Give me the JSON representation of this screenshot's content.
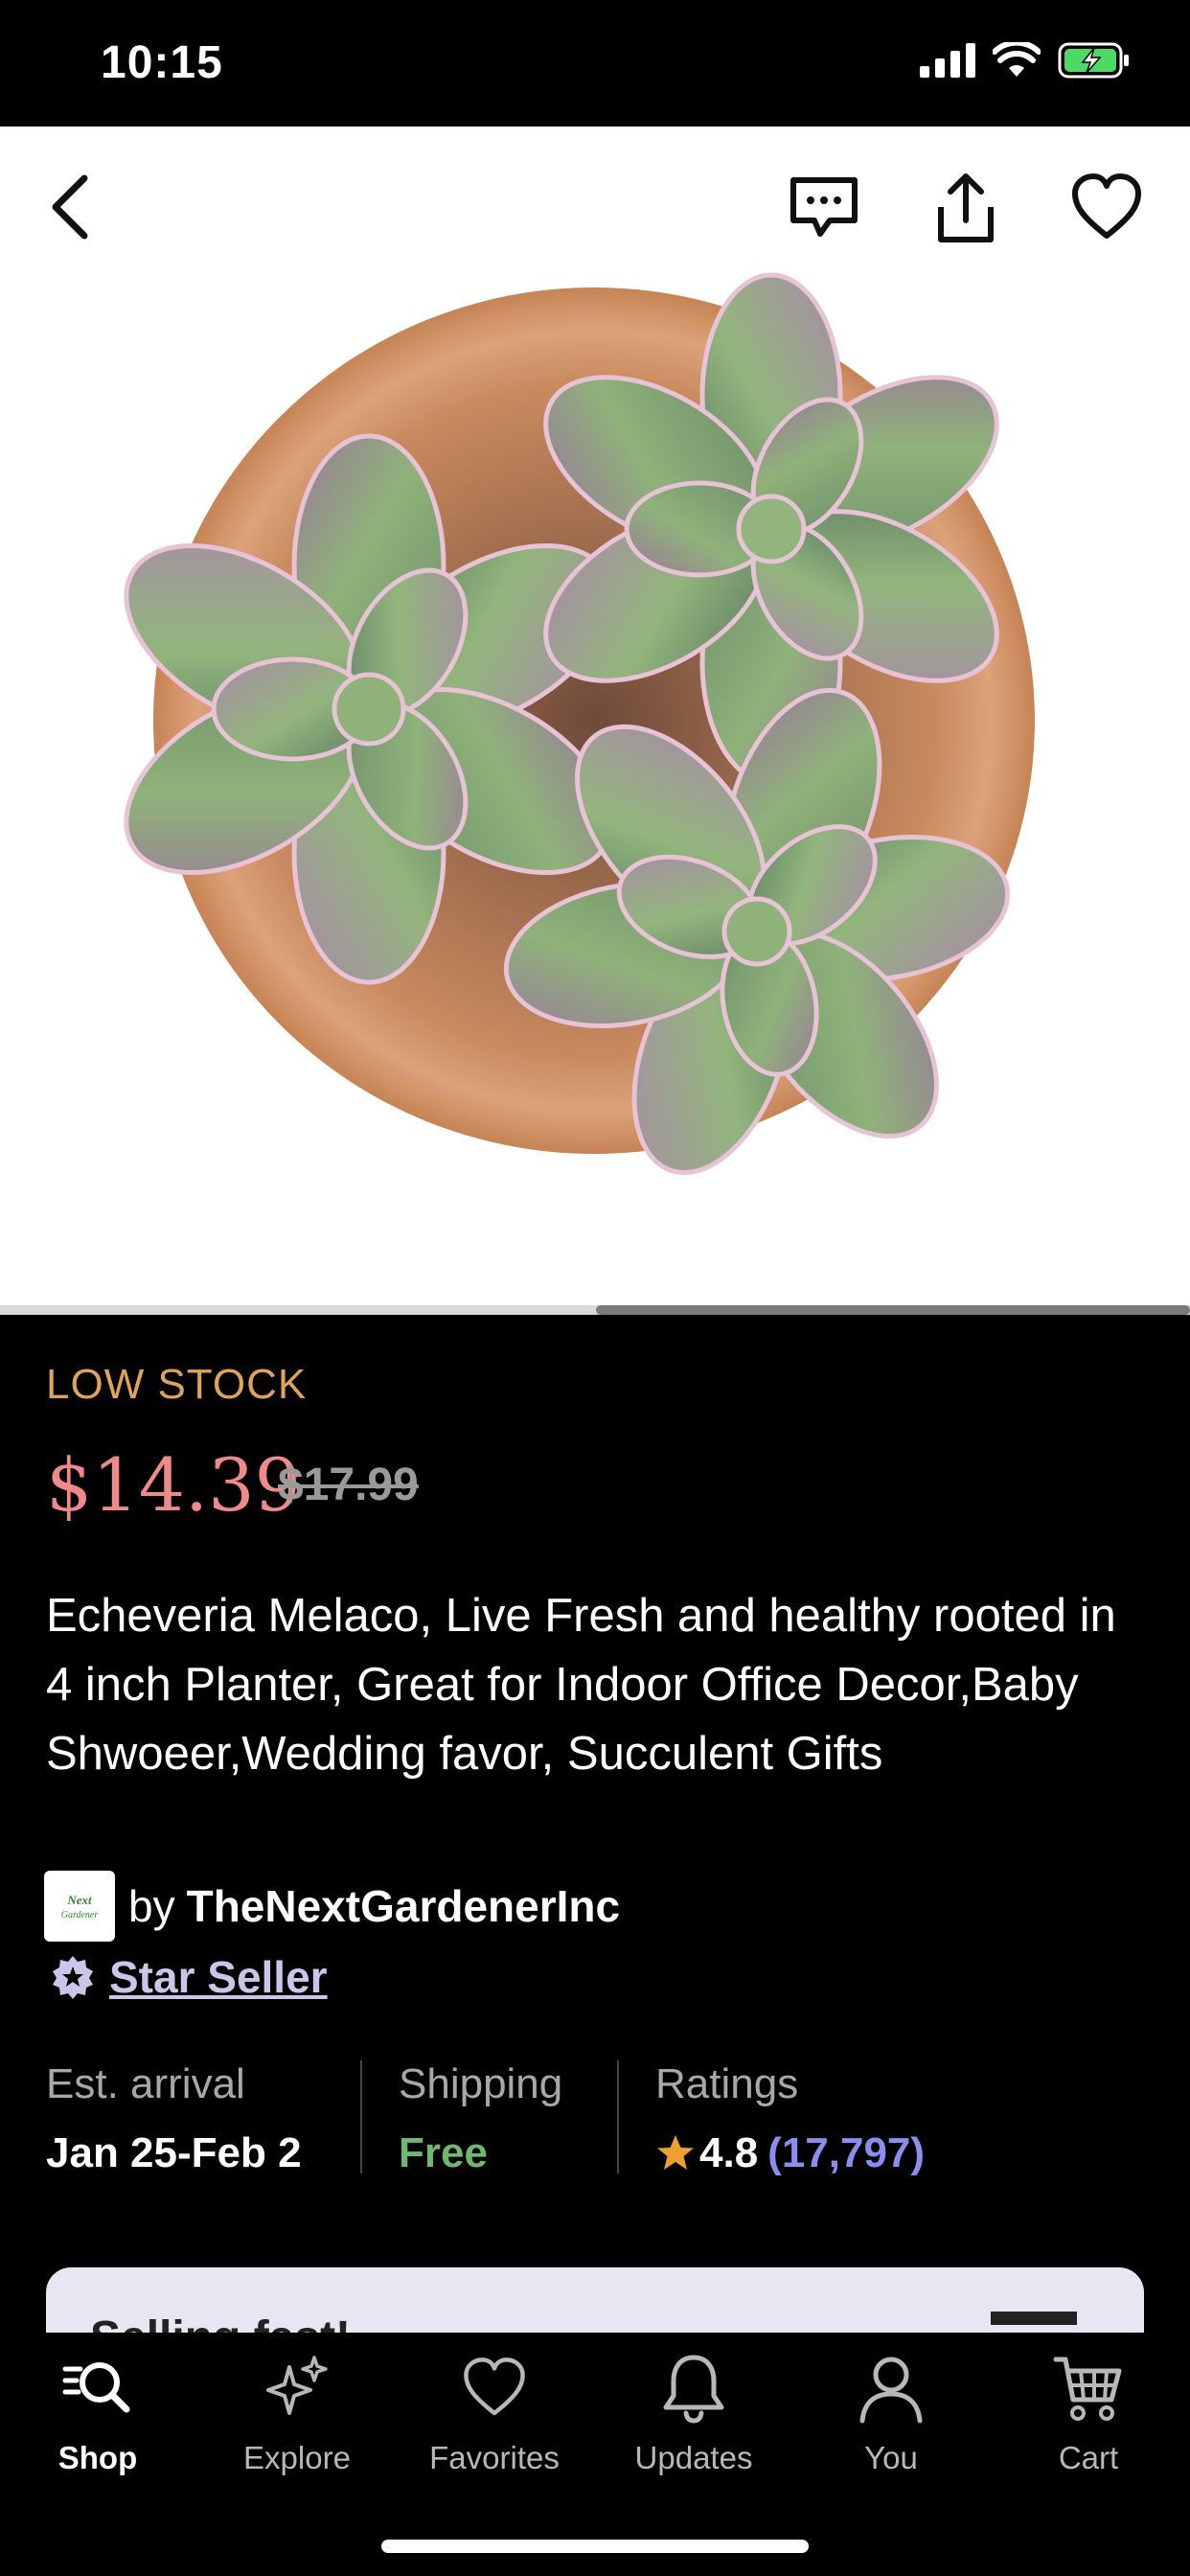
{
  "status_bar": {
    "time": "10:15"
  },
  "product_header": {
    "icons": [
      "back-chevron-icon",
      "message-icon",
      "share-icon",
      "heart-icon"
    ]
  },
  "product": {
    "stock_label": "LOW STOCK",
    "price": "$14.39",
    "original_price": "$17.99",
    "title": "Echeveria Melaco, Live Fresh and healthy rooted in 4 inch Planter, Great for Indoor Office Decor,Baby Shwoeer,Wedding favor, Succulent Gifts",
    "image_carousel_position": 0.5
  },
  "shop": {
    "by_label": "by",
    "name": "TheNextGardenerInc",
    "logo_text": "Next Gardener",
    "badge": "Star Seller"
  },
  "info": {
    "arrival_label": "Est. arrival",
    "arrival_value": "Jan 25-Feb 2",
    "shipping_label": "Shipping",
    "shipping_value": "Free",
    "ratings_label": "Ratings",
    "rating_value": "4.8",
    "rating_count": "(17,797)"
  },
  "promo_card": {
    "text": "Selling fast!"
  },
  "tabs": [
    {
      "label": "Shop",
      "icon": "shop-search-icon",
      "active": true
    },
    {
      "label": "Explore",
      "icon": "sparkle-icon",
      "active": false
    },
    {
      "label": "Favorites",
      "icon": "heart-icon",
      "active": false
    },
    {
      "label": "Updates",
      "icon": "bell-icon",
      "active": false
    },
    {
      "label": "You",
      "icon": "person-icon",
      "active": false
    },
    {
      "label": "Cart",
      "icon": "cart-icon",
      "active": false
    }
  ],
  "colors": {
    "low_stock": "#e0a458",
    "price": "#f08a8a",
    "free": "#6fb86f",
    "rating_count": "#8a8ef0",
    "star": "#f0a030"
  }
}
